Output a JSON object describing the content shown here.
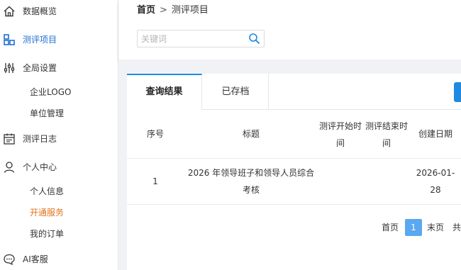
{
  "sidebar": {
    "items": [
      {
        "label": "数据概览",
        "icon": "home-icon"
      },
      {
        "label": "测评项目",
        "icon": "grid-icon",
        "active": true
      },
      {
        "label": "全局设置",
        "icon": "sliders-icon"
      },
      {
        "label": "测评日志",
        "icon": "calendar-icon"
      },
      {
        "label": "个人中心",
        "icon": "user-icon"
      },
      {
        "label": "AI客服",
        "icon": "chat-icon"
      }
    ],
    "settings_sub": [
      "企业LOGO",
      "单位管理"
    ],
    "profile_sub": [
      "个人信息",
      "开通服务",
      "我的订单"
    ]
  },
  "breadcrumb": {
    "home": "首页",
    "separator": ">",
    "current": "测评项目"
  },
  "search": {
    "placeholder": "关键词",
    "value": ""
  },
  "tabs": {
    "results": "查询结果",
    "archived": "已存档"
  },
  "table": {
    "headers": {
      "index": "序号",
      "title": "标题",
      "start_l1": "测评开始时",
      "start_l2": "间",
      "end_l1": "测评结束时",
      "end_l2": "间",
      "created": "创建日期"
    },
    "rows": [
      {
        "index": "1",
        "title_l1": "2026 年领导班子和领导人员综合",
        "title_l2": "考核",
        "start": "",
        "end": "",
        "created_l1": "2026-01-",
        "created_l2": "28"
      }
    ]
  },
  "pagination": {
    "first": "首页",
    "current": "1",
    "last": "末页",
    "total": "共"
  },
  "colors": {
    "accent": "#1f8ae0",
    "active_nav": "#1f6fd1",
    "active_sub": "#e0741c",
    "page_current": "#5aa8f0"
  }
}
